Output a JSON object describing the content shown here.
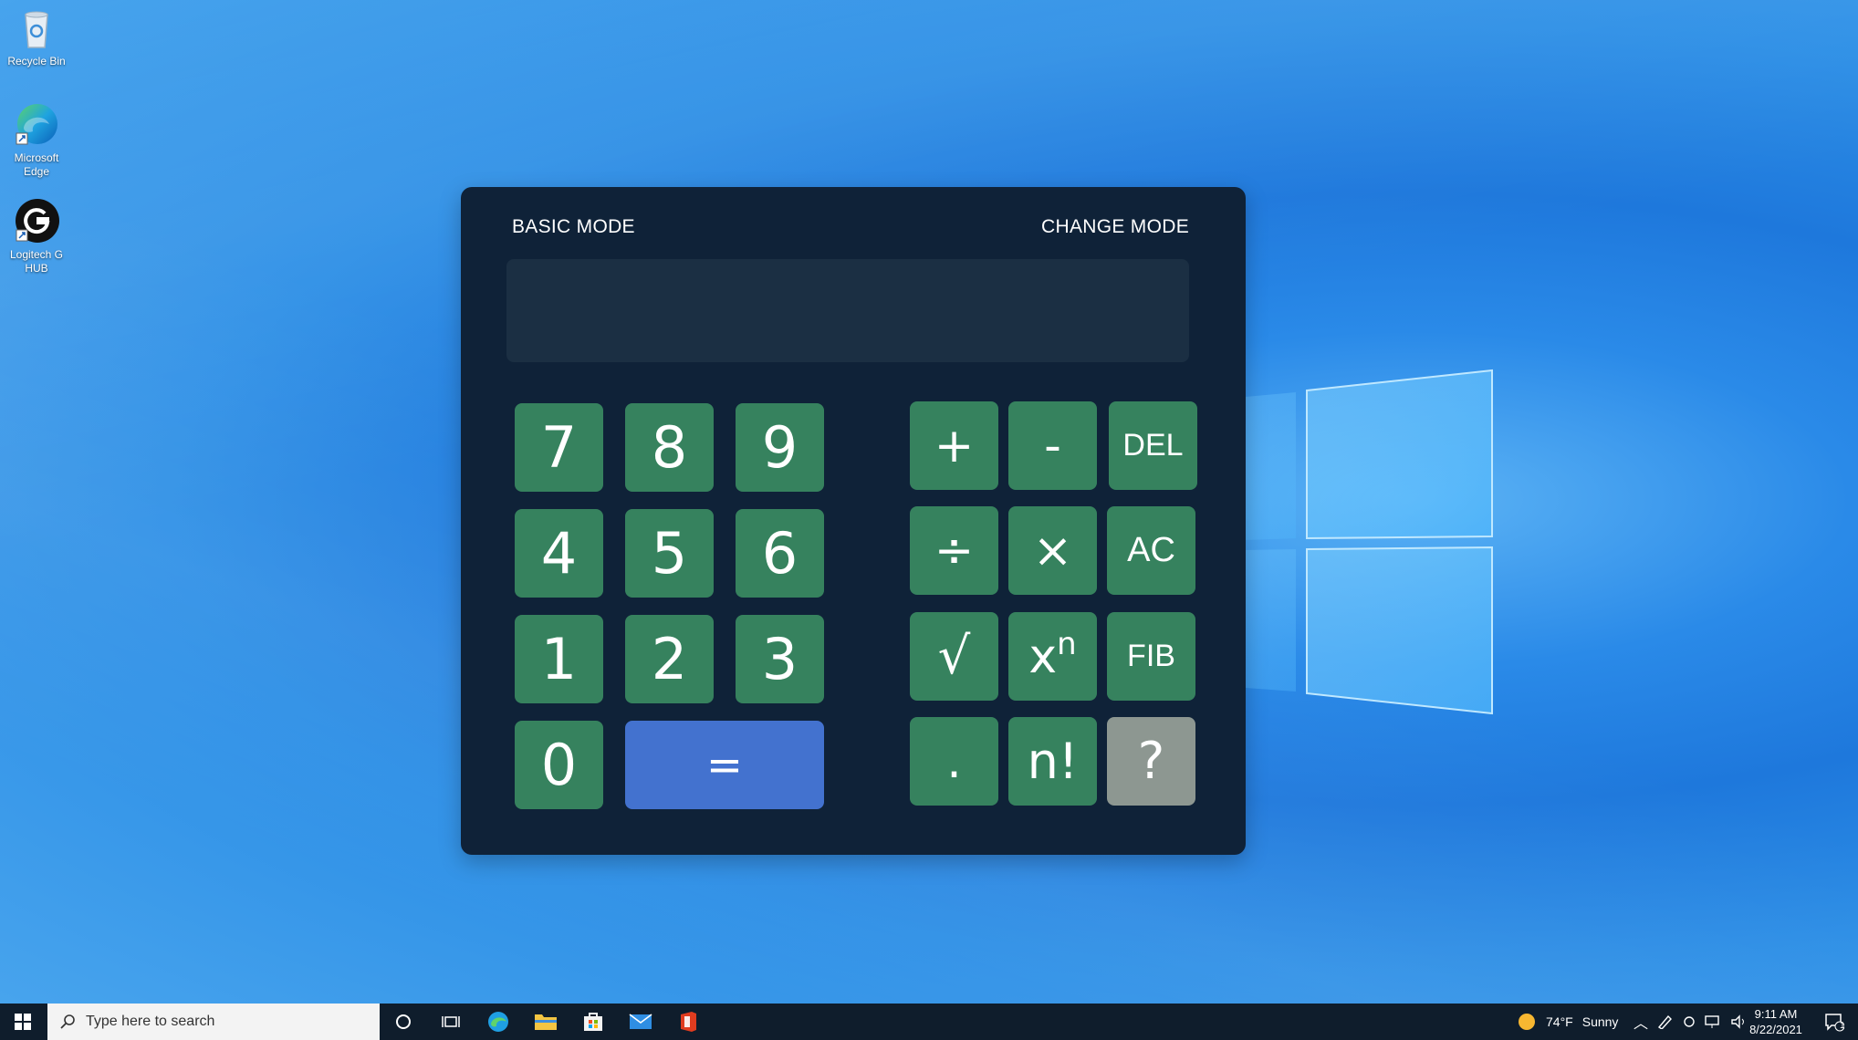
{
  "desktop": {
    "icons": [
      {
        "label": "Recycle Bin",
        "icon": "recycle-bin-icon"
      },
      {
        "label": "Microsoft Edge",
        "icon": "edge-icon"
      },
      {
        "label": "Logitech G HUB",
        "icon": "logitech-g-hub-icon"
      }
    ]
  },
  "calculator": {
    "mode_label": "BASIC MODE",
    "change_mode": "CHANGE MODE",
    "display_value": "",
    "keys": {
      "k7": "7",
      "k8": "8",
      "k9": "9",
      "k4": "4",
      "k5": "5",
      "k6": "6",
      "k1": "1",
      "k2": "2",
      "k3": "3",
      "k0": "0",
      "equals": "=",
      "plus": "+",
      "minus": "-",
      "del": "DEL",
      "divide": "÷",
      "multiply": "×",
      "ac": "AC",
      "sqrt": "√",
      "power_base": "x",
      "power_exp": "n",
      "fib": "FIB",
      "dot": ".",
      "factorial": "n!",
      "help": "?"
    }
  },
  "taskbar": {
    "search_placeholder": "Type here to search",
    "weather_temp": "74°F",
    "weather_desc": "Sunny",
    "time": "9:11 AM",
    "date": "8/22/2021",
    "notification_count": "1"
  },
  "colors": {
    "calc_bg": "#0f2238",
    "key_green": "#36825e",
    "key_blue": "#4372cf",
    "key_gray": "#8d9791"
  }
}
